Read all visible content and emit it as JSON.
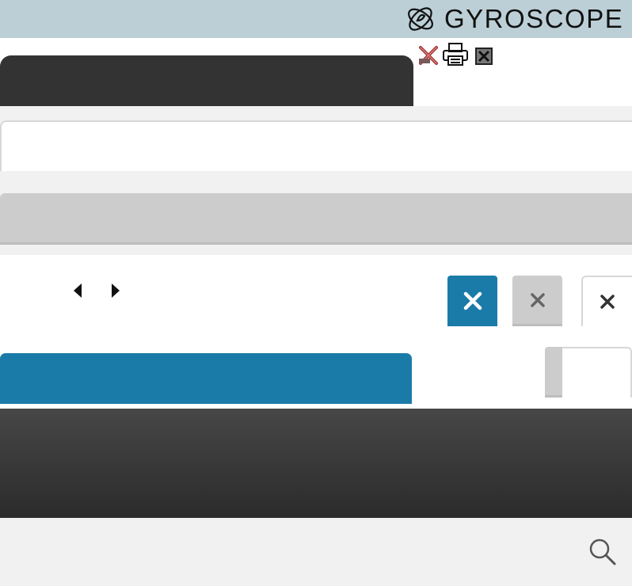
{
  "header": {
    "brand_name": "GYROSCOPE",
    "logo_icon": "gyroscope-logo-icon",
    "background_color": "#bccfd6"
  },
  "toolbar": {
    "icons": [
      "delete-icon",
      "print-icon",
      "close-box-icon"
    ]
  },
  "navigation": {
    "prev_icon": "caret-left-icon",
    "next_icon": "caret-right-icon"
  },
  "close_buttons": {
    "icon": "close-icon",
    "glyph": "✕",
    "styles": [
      "primary",
      "secondary",
      "outline"
    ]
  },
  "search": {
    "icon": "search-icon"
  },
  "colors": {
    "accent_blue": "#1a7ba8",
    "dark": "#333333",
    "light_gray": "#cccccc",
    "page_bg": "#f1f1f1"
  }
}
